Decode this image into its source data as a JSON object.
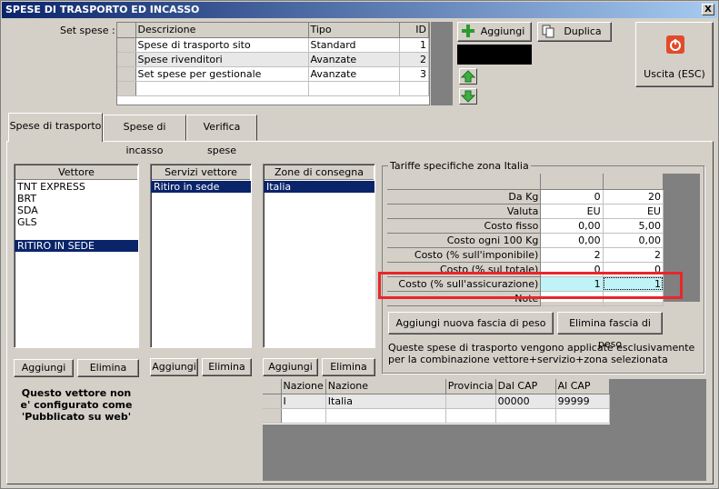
{
  "window": {
    "title": "SPESE DI TRASPORTO ED INCASSO",
    "close_glyph": "X"
  },
  "set_spese": {
    "label": "Set spese :",
    "columns": [
      "Descrizione",
      "Tipo",
      "ID"
    ],
    "rows": [
      {
        "descrizione": "Spese di trasporto sito",
        "tipo": "Standard",
        "id": "1"
      },
      {
        "descrizione": "Spese rivenditori",
        "tipo": "Avanzate",
        "id": "2"
      },
      {
        "descrizione": "Set spese per gestionale",
        "tipo": "Avanzate",
        "id": "3"
      }
    ]
  },
  "buttons": {
    "aggiungi": "Aggiungi",
    "duplica": "Duplica",
    "uscita": "Uscita (ESC)"
  },
  "tabs": [
    "Spese di trasporto",
    "Spese di incasso",
    "Verifica spese"
  ],
  "vettore": {
    "header": "Vettore",
    "items": [
      "TNT EXPRESS",
      "BRT",
      "SDA",
      "GLS",
      "",
      "RITIRO IN SEDE"
    ],
    "selected_index": 5,
    "add": "Aggiungi",
    "remove": "Elimina",
    "note": "Questo vettore non e' configurato come 'Pubblicato su web'"
  },
  "servizi": {
    "header": "Servizi vettore",
    "items": [
      "Ritiro in sede"
    ],
    "add": "Aggiungi",
    "remove": "Elimina"
  },
  "zone": {
    "header": "Zone di consegna",
    "items": [
      "Italia"
    ],
    "add": "Aggiungi",
    "remove": "Elimina"
  },
  "tariffe": {
    "title": "Tariffe specifiche zona Italia",
    "rows": [
      {
        "label": "Da Kg",
        "v1": "0",
        "v2": "20"
      },
      {
        "label": "Valuta",
        "v1": "EU",
        "v2": "EU"
      },
      {
        "label": "Costo fisso",
        "v1": "0,00",
        "v2": "5,00"
      },
      {
        "label": "Costo ogni 100 Kg",
        "v1": "0,00",
        "v2": "0,00"
      },
      {
        "label": "Costo (% sull'imponibile)",
        "v1": "2",
        "v2": "2"
      },
      {
        "label": "Costo (% sul totale)",
        "v1": "0",
        "v2": "0"
      },
      {
        "label": "Costo (% sull'assicurazione)",
        "v1": "1",
        "v2": "1"
      },
      {
        "label": "Note",
        "v1": "",
        "v2": ""
      }
    ],
    "add_band": "Aggiungi nuova fascia di peso",
    "remove_band": "Elimina fascia di peso",
    "info": "Queste spese di trasporto vengono applicate esclusivamente per la combinazione vettore+servizio+zona selezionata"
  },
  "cap_table": {
    "columns": [
      "Nazione",
      "Nazione",
      "Provincia",
      "Dal CAP",
      "Al CAP"
    ],
    "rows": [
      {
        "c1": "I",
        "c2": "Italia",
        "c3": "",
        "c4": "00000",
        "c5": "99999"
      }
    ]
  },
  "colors": {
    "highlight": "#e8262b",
    "selection": "#0a246a",
    "cyan_cell": "#bff3f7"
  }
}
